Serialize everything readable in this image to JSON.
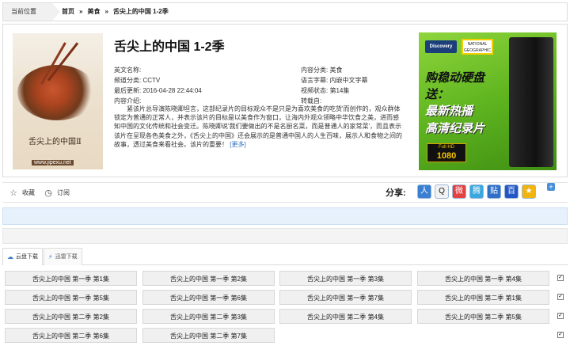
{
  "breadcrumb": {
    "current_label": "当前位置",
    "home": "首页",
    "category": "美食",
    "title": "舌尖上的中国 1-2季",
    "separator": "»"
  },
  "poster": {
    "title": "舌尖上的中国Ⅱ",
    "url": "www.jipexu.net"
  },
  "detail": {
    "title": "舌尖上的中国 1-2季",
    "fields": {
      "english_name": "英文名称:",
      "content_category": "内容分类: 美食",
      "channel": "频道分类: CCTV",
      "subtitle_lang": "语言字幕: 内嵌中文字幕",
      "last_update": "最后更新: 2016-04-28 22:44:04",
      "status": "视频状态: 第14集",
      "intro_label": "内容介绍:",
      "contributor": "转载自:"
    },
    "description": "紧该片总导演陈晓卿坦言，这部纪录片的目标观众不是只是为喜欢美食的吃货'而创作的，观众群体锁定为普通的正常人，并表示该片的目标是以美食作为窗口，让海内外观众领略中华饮食之美，进而感知中国的文化传统和社会变迁。陈晓卿说'我们要做出的不是名厨名菜，而是普通人的家常菜'，而且表示该片在呈现各色美食之外，《舌尖上的中国》还会展示的是普通中国人的人生百味，展示人和食物之间的故事，透过美食来看社会。该片的重要！",
    "more": "[更多]"
  },
  "ad": {
    "brand1": "Discovery",
    "brand2": "NATIONAL GEOGRAPHIC",
    "line1": "购稳动硬盘",
    "line2": "送：",
    "line3": "最新热播",
    "line4": "高清纪录片",
    "hd_top": "Full HD",
    "hd_bottom": "1080"
  },
  "actions": {
    "favorite": "收藏",
    "subscribe": "订阅",
    "share_label": "分享:",
    "share_icons": [
      "renren-icon",
      "qq-icon",
      "weibo-icon",
      "tencent-weibo-icon",
      "tieba-icon",
      "baidu-icon",
      "qzone-icon"
    ]
  },
  "downloads": {
    "tab_cloud": "云盘下载",
    "tab_magnet": "迅雷下载",
    "episodes": [
      [
        "舌尖上的中国 第一季 第1集",
        "舌尖上的中国 第一季 第2集",
        "舌尖上的中国 第一季 第3集",
        "舌尖上的中国 第一季 第4集"
      ],
      [
        "舌尖上的中国 第一季 第5集",
        "舌尖上的中国 第一季 第6集",
        "舌尖上的中国 第一季 第7集",
        "舌尖上的中国 第二季 第1集"
      ],
      [
        "舌尖上的中国 第二季 第2集",
        "舌尖上的中国 第二季 第3集",
        "舌尖上的中国 第二季 第4集",
        "舌尖上的中国 第二季 第5集"
      ],
      [
        "舌尖上的中国 第二季 第6集",
        "舌尖上的中国 第二季 第7集"
      ]
    ]
  }
}
